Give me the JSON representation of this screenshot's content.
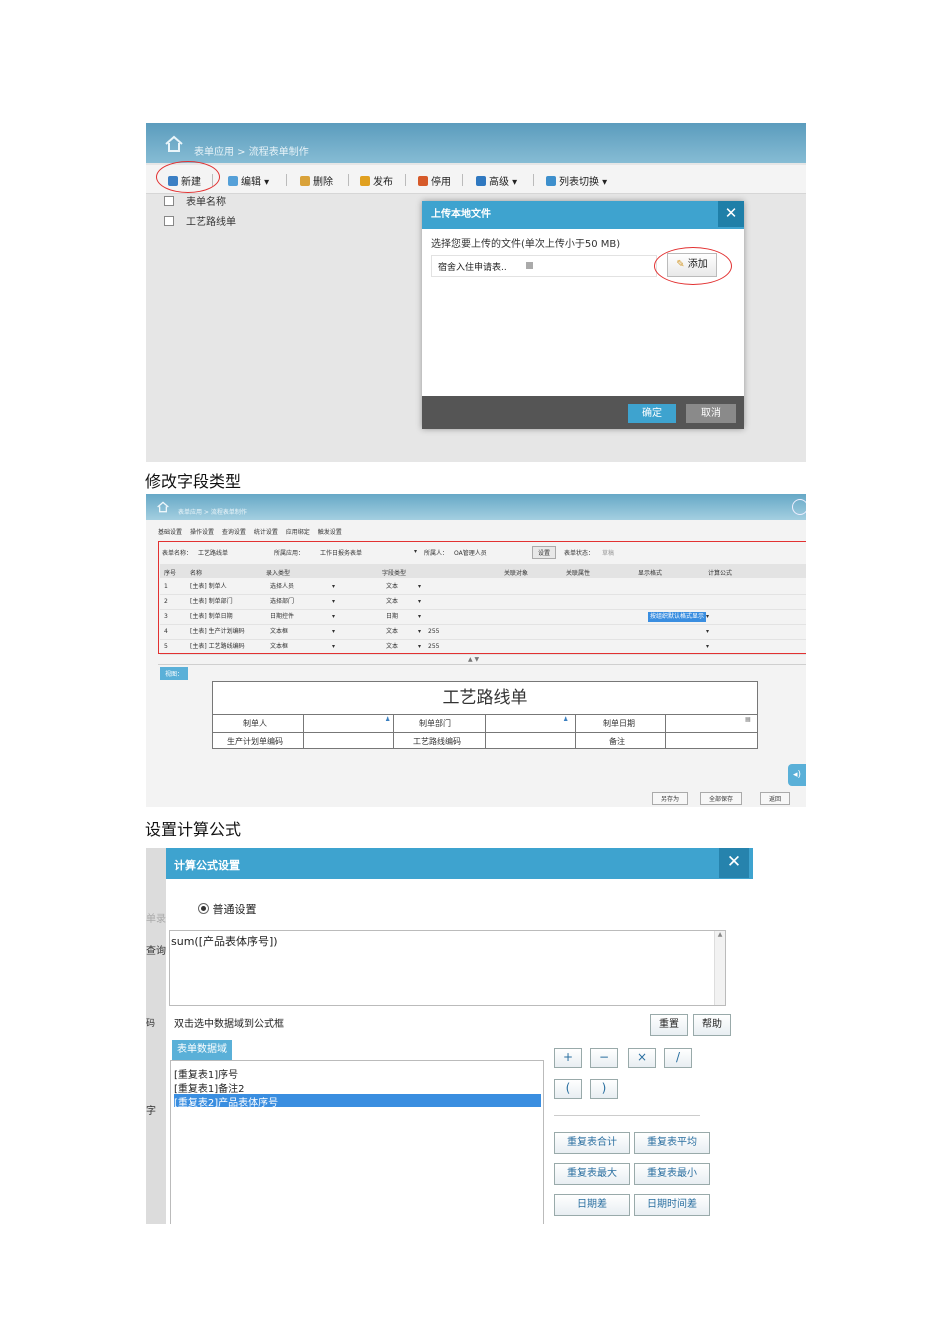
{
  "captions": {
    "field_type": "修改字段类型",
    "formula": "设置计算公式"
  },
  "shot1": {
    "breadcrumb": "表单应用 > 流程表单制作",
    "toolbar": {
      "new": "新建",
      "edit": "编辑",
      "delete": "删除",
      "publish": "发布",
      "disable": "停用",
      "advanced": "高级",
      "list_switch": "列表切换"
    },
    "list_header": "表单名称",
    "list_rows": [
      "工艺路线单"
    ],
    "dialog": {
      "title": "上传本地文件",
      "instruction": "选择您要上传的文件(单次上传小于50 MB)",
      "file_name": "宿舍入住申请表..",
      "add_button": "添加",
      "ok_button": "确定",
      "cancel_button": "取消"
    }
  },
  "shot2": {
    "breadcrumb": "表单应用 > 流程表单制作",
    "tabs": [
      "基础设置",
      "操作设置",
      "查询设置",
      "统计设置",
      "应用绑定",
      "触发设置"
    ],
    "meta": {
      "form_name_label": "表单名称：",
      "form_name": "工艺路线单",
      "app_label": "所属应用：",
      "app_value": "工作日报务表单",
      "owner_label": "所属人：",
      "owner_value": "OA管理人员",
      "settings_btn": "设置",
      "status_label": "表单状态：",
      "status_value": "草稿"
    },
    "columns": [
      "序号",
      "名称",
      "录入类型",
      "字段类型",
      "关联对象",
      "关联属性",
      "显示格式",
      "计算公式"
    ],
    "rows": [
      {
        "no": "1",
        "name": "[主表] 制单人",
        "input": "选择人员",
        "type": "文本",
        "len": "",
        "fmt": ""
      },
      {
        "no": "2",
        "name": "[主表] 制单部门",
        "input": "选择部门",
        "type": "文本",
        "len": "",
        "fmt": ""
      },
      {
        "no": "3",
        "name": "[主表] 制单日期",
        "input": "日期控件",
        "type": "日期",
        "len": "",
        "fmt": "按组织默认格式显示"
      },
      {
        "no": "4",
        "name": "[主表] 生产计划编码",
        "input": "文本框",
        "type": "文本",
        "len": "255",
        "fmt": ""
      },
      {
        "no": "5",
        "name": "[主表] 工艺路线编码",
        "input": "文本框",
        "type": "文本",
        "len": "255",
        "fmt": ""
      }
    ],
    "view_label": "视图：",
    "form": {
      "title": "工艺路线单",
      "labels": [
        "制单人",
        "制单部门",
        "制单日期",
        "生产计划单编码",
        "工艺路线编码",
        "备注"
      ]
    },
    "buttons": {
      "save_as": "另存为",
      "save_all": "全部保存",
      "back": "返回"
    }
  },
  "shot3": {
    "title": "计算公式设置",
    "radio": "普通设置",
    "formula": "sum([产品表体序号])",
    "hint": "双击选中数据域到公式框",
    "reset": "重置",
    "help": "帮助",
    "tab": "表单数据域",
    "fields": [
      "[重复表1]序号",
      "[重复表1]备注2",
      "[重复表2]产品表体序号"
    ],
    "ops": [
      "+",
      "−",
      "×",
      "/",
      "(",
      ")"
    ],
    "functions": [
      "重复表合计",
      "重复表平均",
      "重复表最大",
      "重复表最小",
      "日期差",
      "日期时间差"
    ],
    "edge_fragments": [
      "单录",
      "查询",
      "码",
      "字"
    ]
  }
}
